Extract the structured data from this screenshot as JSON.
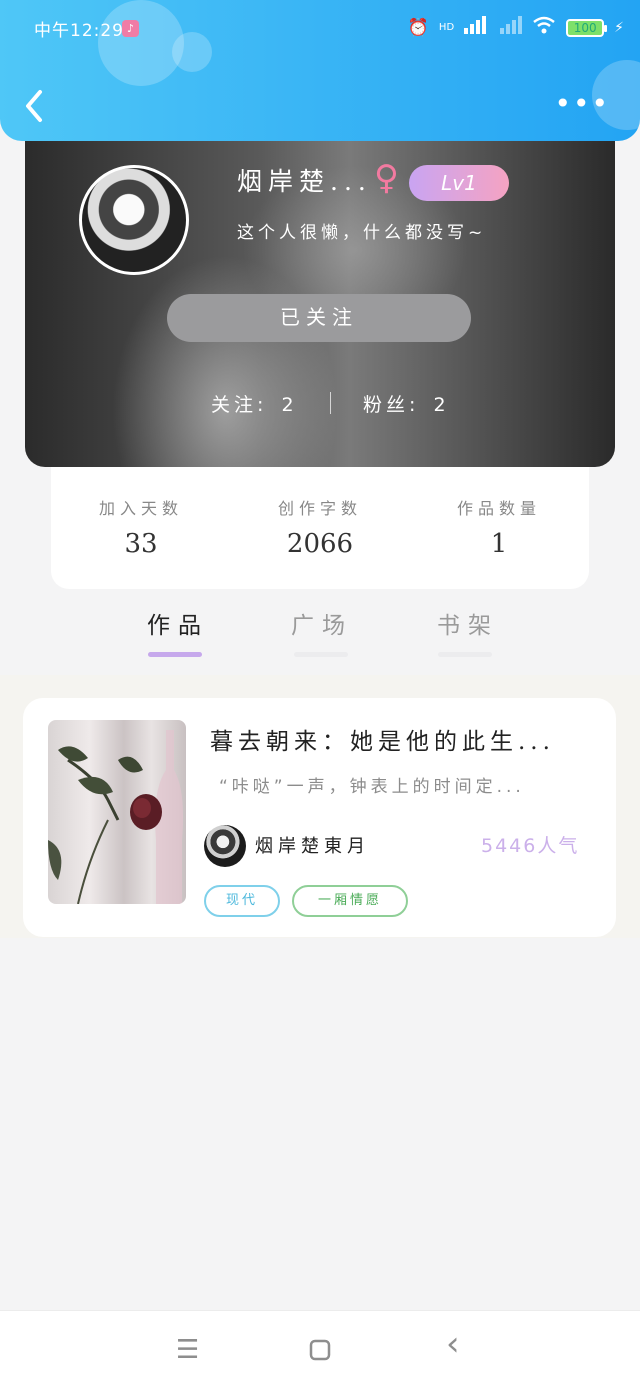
{
  "status_bar": {
    "time": "中午12:29",
    "battery": "100",
    "network": "HD"
  },
  "header": {
    "back_icon": "chevron-left-icon",
    "more_icon": "more-dots-icon"
  },
  "profile": {
    "username": "烟岸楚...",
    "gender_symbol": "♀",
    "level": "Lv1",
    "bio": "这个人很懒，什么都没写~",
    "follow_button": "已关注",
    "following_label": "关注:",
    "following_count": "2",
    "fans_label": "粉丝:",
    "fans_count": "2"
  },
  "stats": [
    {
      "label": "加入天数",
      "value": "33"
    },
    {
      "label": "创作字数",
      "value": "2066"
    },
    {
      "label": "作品数量",
      "value": "1"
    }
  ],
  "tabs": [
    {
      "label": "作品",
      "active": true
    },
    {
      "label": "广场",
      "active": false
    },
    {
      "label": "书架",
      "active": false
    }
  ],
  "works": [
    {
      "title": "暮去朝来：她是他的此生...",
      "excerpt": "“咔哒”一声，钟表上的时间定...",
      "author": "烟岸楚東月",
      "popularity": "5446人气",
      "tags": [
        "现代",
        "一厢情愿"
      ]
    }
  ],
  "nav": {
    "menu_icon": "☰",
    "home_icon": "▢",
    "back_icon": "‹"
  },
  "colors": {
    "header_blue": "#2aa8f4",
    "level_gradient_start": "#c9a4f2",
    "level_gradient_end": "#f5a3c2",
    "tab_indicator": "#c6a8ec",
    "popularity": "#cbb0ea"
  }
}
